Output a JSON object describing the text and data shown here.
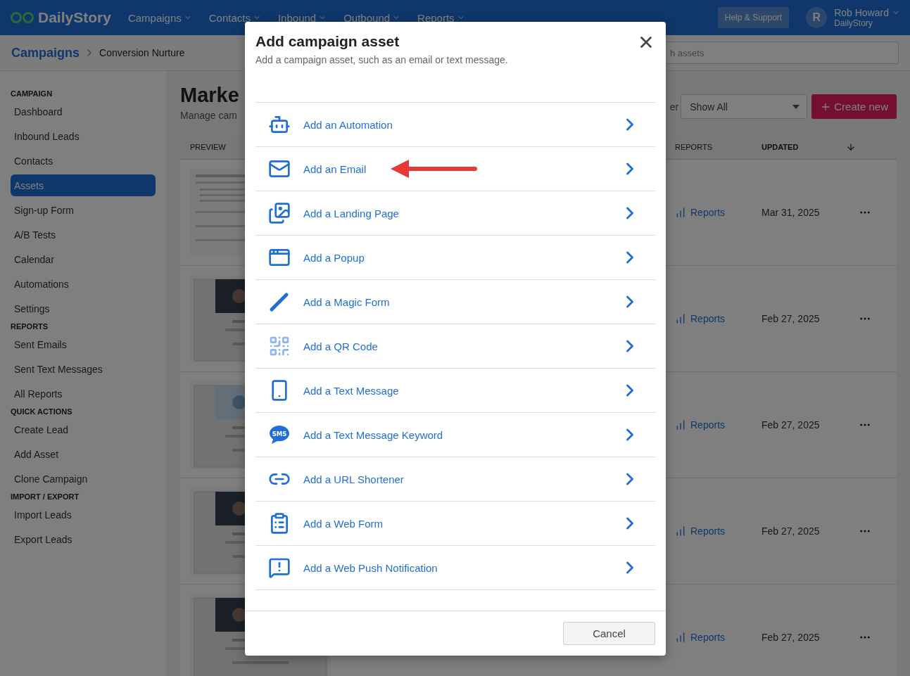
{
  "topbar": {
    "logo": "DailyStory",
    "menus": [
      "Campaigns",
      "Contacts",
      "Inbound",
      "Outbound",
      "Reports"
    ],
    "help": "Help & Support",
    "user": {
      "initial": "R",
      "name": "Rob Howard",
      "org": "DailyStory"
    }
  },
  "breadcrumb": {
    "root": "Campaigns",
    "current": "Conversion Nurture"
  },
  "search": {
    "placeholder": "h assets"
  },
  "sidebar": [
    {
      "title": "CAMPAIGN",
      "items": [
        {
          "label": "Dashboard",
          "selected": false
        },
        {
          "label": "Inbound Leads",
          "selected": false
        },
        {
          "label": "Contacts",
          "selected": false
        },
        {
          "label": "Assets",
          "selected": true
        },
        {
          "label": "Sign-up Form",
          "selected": false
        },
        {
          "label": "A/B Tests",
          "selected": false
        },
        {
          "label": "Calendar",
          "selected": false
        },
        {
          "label": "Automations",
          "selected": false
        },
        {
          "label": "Settings",
          "selected": false
        }
      ]
    },
    {
      "title": "REPORTS",
      "items": [
        {
          "label": "Sent Emails",
          "selected": false
        },
        {
          "label": "Sent Text Messages",
          "selected": false
        },
        {
          "label": "All Reports",
          "selected": false
        }
      ]
    },
    {
      "title": "QUICK ACTIONS",
      "items": [
        {
          "label": "Create Lead",
          "selected": false
        },
        {
          "label": "Add Asset",
          "selected": false
        },
        {
          "label": "Clone Campaign",
          "selected": false
        }
      ]
    },
    {
      "title": "IMPORT / EXPORT",
      "items": [
        {
          "label": "Import Leads",
          "selected": false
        },
        {
          "label": "Export Leads",
          "selected": false
        }
      ]
    }
  ],
  "page": {
    "title": "Marke",
    "subtitle": "Manage cam",
    "filter_label": "er",
    "filter": "Show All",
    "create": "Create new"
  },
  "table": {
    "columns": [
      {
        "label": "PREVIEW",
        "sorted": false
      },
      {
        "label": "REPORTS",
        "sorted": false
      },
      {
        "label": "UPDATED",
        "sorted": true
      }
    ],
    "rows": [
      {
        "reports": "Reports",
        "updated": "Mar 31, 2025"
      },
      {
        "reports": "Reports",
        "updated": "Feb 27, 2025"
      },
      {
        "reports": "Reports",
        "updated": "Feb 27, 2025"
      },
      {
        "reports": "Reports",
        "updated": "Feb 27, 2025"
      },
      {
        "reports": "Reports",
        "updated": "Feb 27, 2025"
      }
    ]
  },
  "modal": {
    "title": "Add campaign asset",
    "subtitle": "Add a campaign asset, such as an email or text message.",
    "items": [
      {
        "kind": "automation",
        "label": "Add an Automation",
        "pointed": false
      },
      {
        "kind": "email",
        "label": "Add an Email",
        "pointed": true
      },
      {
        "kind": "landing",
        "label": "Add a Landing Page",
        "pointed": false
      },
      {
        "kind": "popup",
        "label": "Add a Popup",
        "pointed": false
      },
      {
        "kind": "magic",
        "label": "Add a Magic Form",
        "pointed": false
      },
      {
        "kind": "qr",
        "label": "Add a QR Code",
        "pointed": false
      },
      {
        "kind": "text",
        "label": "Add a Text Message",
        "pointed": false
      },
      {
        "kind": "sms",
        "label": "Add a Text Message Keyword",
        "pointed": false,
        "icon_text": "SMS"
      },
      {
        "kind": "url",
        "label": "Add a URL Shortener",
        "pointed": false
      },
      {
        "kind": "webform",
        "label": "Add a Web Form",
        "pointed": false
      },
      {
        "kind": "push",
        "label": "Add a Web Push Notification",
        "pointed": false
      }
    ],
    "cancel": "Cancel"
  }
}
